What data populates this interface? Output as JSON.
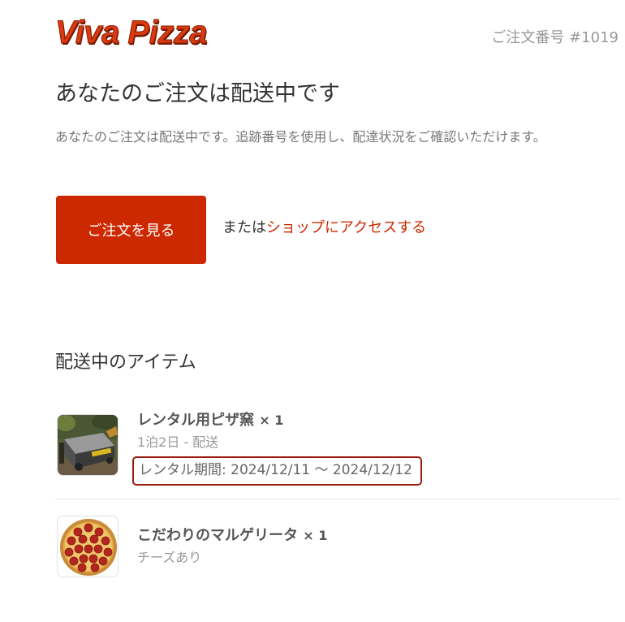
{
  "brand": {
    "logo_text": "Viva Pizza",
    "accent_color": "#cc2900"
  },
  "order": {
    "number_label": "ご注文番号 #1019"
  },
  "status": {
    "heading": "あなたのご注文は配送中です",
    "description": "あなたのご注文は配送中です。追跡番号を使用し、配達状況をご確認いただけます。"
  },
  "actions": {
    "view_order_label": "ご注文を見る",
    "or_text": "または",
    "shop_link_label": "ショップにアクセスする"
  },
  "shipping": {
    "section_title": "配送中のアイテム",
    "items": [
      {
        "name": "レンタル用ピザ窯",
        "quantity": "× 1",
        "variant": "1泊2日 - 配送",
        "rental_period": "レンタル期間: 2024/12/11 〜 2024/12/12",
        "image": "pizza-oven-photo"
      },
      {
        "name": "こだわりのマルゲリータ",
        "quantity": "× 1",
        "variant": "チーズあり",
        "image": "pepperoni-pizza-photo"
      }
    ]
  }
}
